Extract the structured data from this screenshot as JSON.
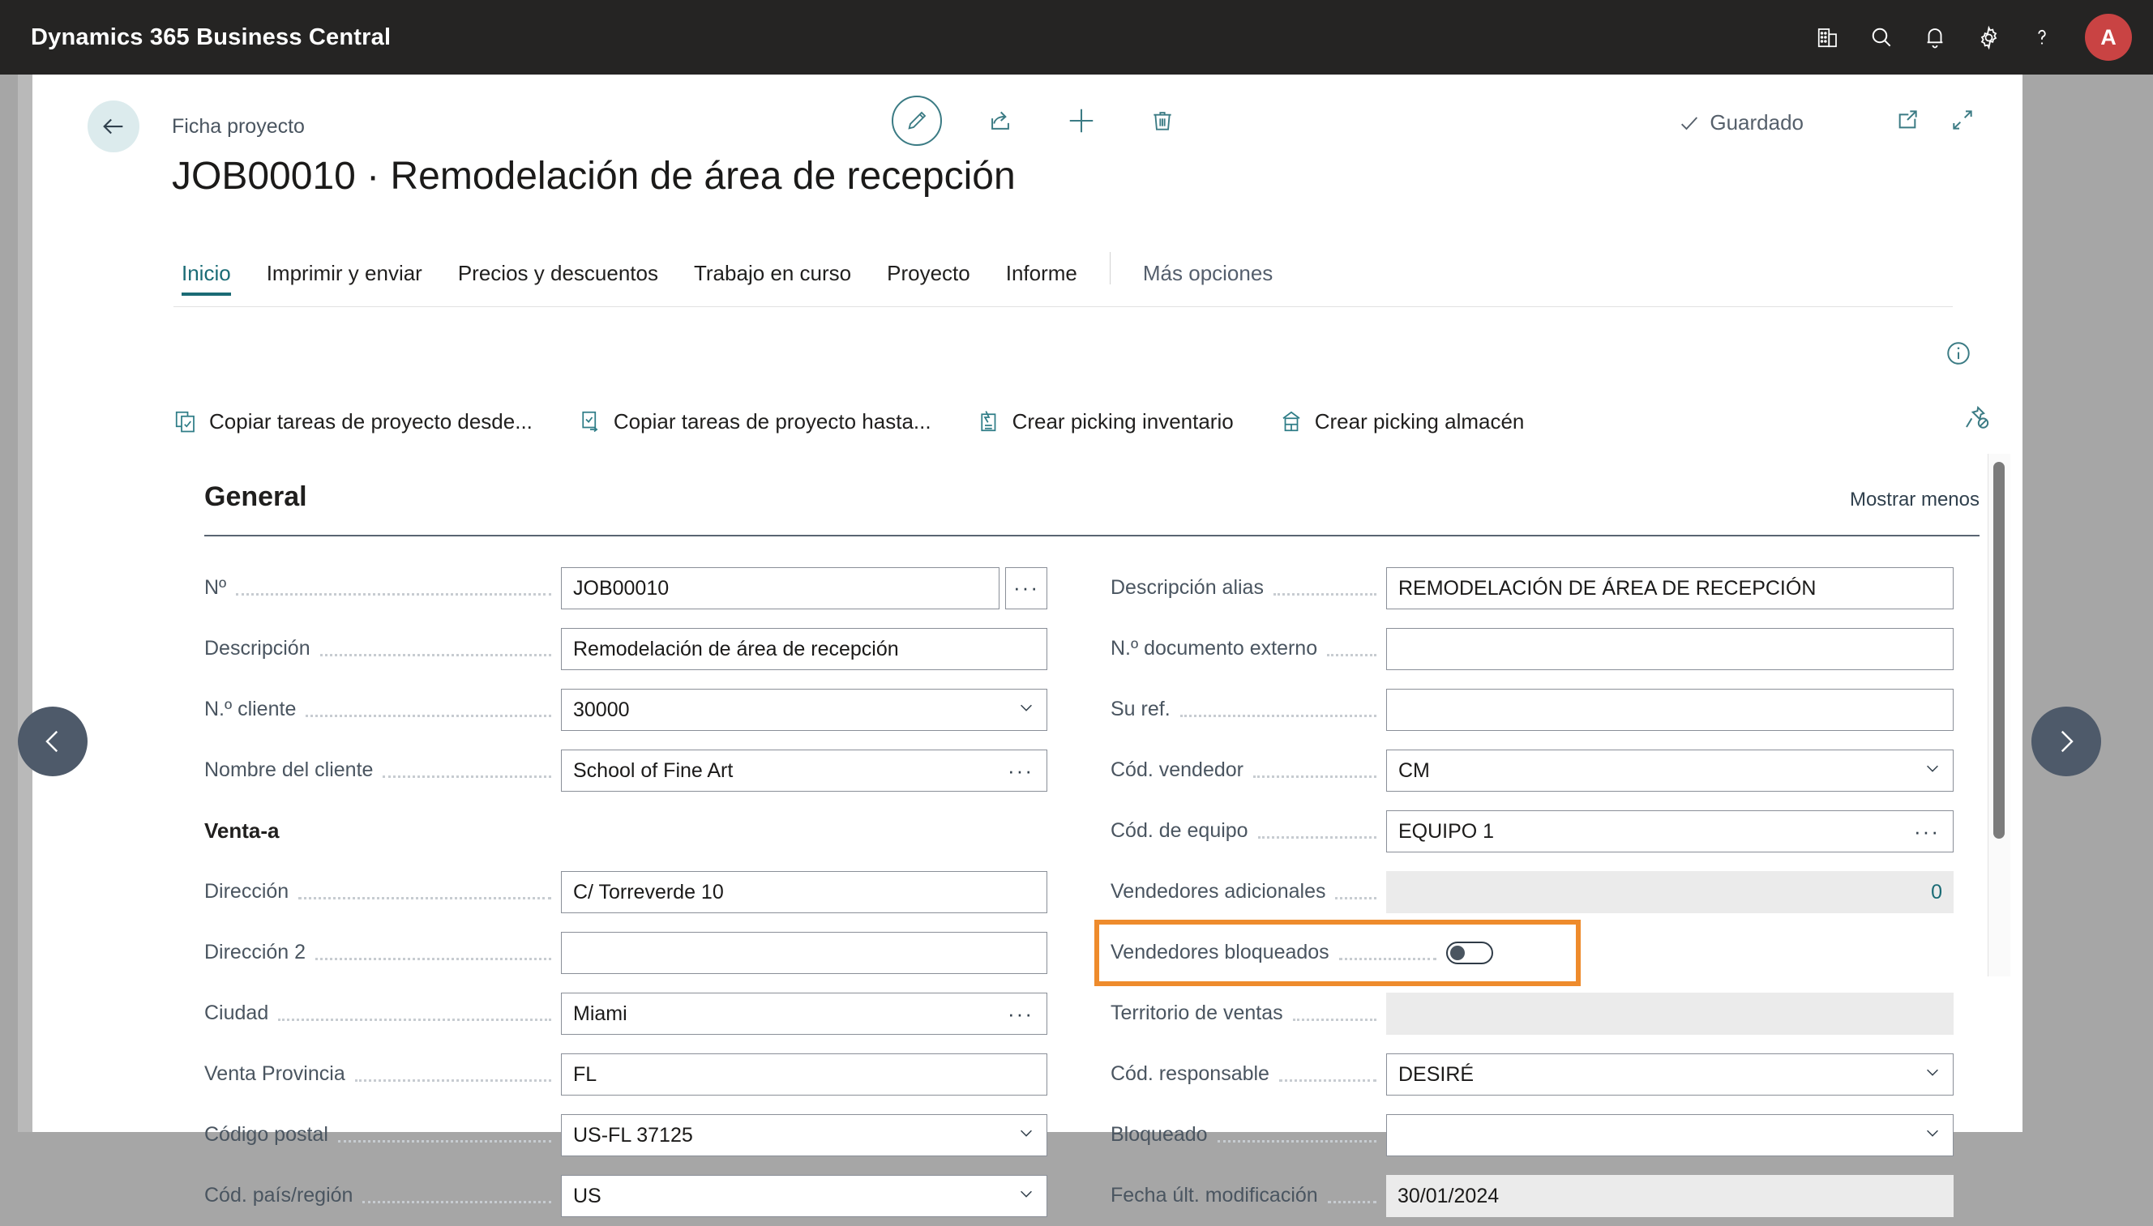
{
  "app": {
    "brand": "Dynamics 365 Business Central",
    "avatar_initial": "A",
    "accent_teal": "#3b7b84",
    "highlight_orange": "#ee8b2c",
    "topbar_bg": "#252423",
    "icons": [
      "company-icon",
      "search-icon",
      "notification-bell-icon",
      "settings-gear-icon",
      "help-question-icon"
    ]
  },
  "command_bar": {
    "back_label": "back-arrow",
    "breadcrumb": "Ficha proyecto",
    "edit_label": "edit-pencil",
    "share_label": "share",
    "new_label": "new",
    "delete_label": "delete",
    "saved_status": "Guardado",
    "open_new_window_label": "open-in-new-window",
    "collapse_label": "collapse"
  },
  "document": {
    "title": "JOB00010 · Remodelación de área de recepción"
  },
  "tabs": [
    {
      "label": "Inicio",
      "active": true
    },
    {
      "label": "Imprimir y enviar",
      "active": false
    },
    {
      "label": "Precios y descuentos",
      "active": false
    },
    {
      "label": "Trabajo en curso",
      "active": false
    },
    {
      "label": "Proyecto",
      "active": false
    },
    {
      "label": "Informe",
      "active": false
    }
  ],
  "tabs_more": "Más opciones",
  "actions": [
    {
      "label": "Copiar tareas de proyecto desde...",
      "icon": "copy-tasks-from-icon"
    },
    {
      "label": "Copiar tareas de proyecto hasta...",
      "icon": "copy-tasks-to-icon"
    },
    {
      "label": "Crear picking inventario",
      "icon": "inventory-pick-icon"
    },
    {
      "label": "Crear picking almacén",
      "icon": "warehouse-pick-icon"
    }
  ],
  "section": {
    "title": "General",
    "toggle_link": "Mostrar menos"
  },
  "form": {
    "left": [
      {
        "type": "field",
        "label": "Nº",
        "value": "JOB00010",
        "control": "assist"
      },
      {
        "type": "field",
        "label": "Descripción",
        "value": "Remodelación de área de recepción",
        "control": "none"
      },
      {
        "type": "field",
        "label": "N.º cliente",
        "value": "30000",
        "control": "dropdown"
      },
      {
        "type": "field",
        "label": "Nombre del cliente",
        "value": "School of Fine Art",
        "control": "ellipsis"
      },
      {
        "type": "subheading",
        "label": "Venta-a"
      },
      {
        "type": "field",
        "label": "Dirección",
        "value": "C/ Torreverde 10",
        "control": "none"
      },
      {
        "type": "field",
        "label": "Dirección 2",
        "value": "",
        "control": "none"
      },
      {
        "type": "field",
        "label": "Ciudad",
        "value": "Miami",
        "control": "ellipsis"
      },
      {
        "type": "field",
        "label": "Venta Provincia",
        "value": "FL",
        "control": "none"
      },
      {
        "type": "field",
        "label": "Código postal",
        "value": "US-FL 37125",
        "control": "dropdown"
      },
      {
        "type": "field",
        "label": "Cód. país/región",
        "value": "US",
        "control": "dropdown"
      }
    ],
    "right": [
      {
        "type": "field",
        "label": "Descripción alias",
        "value": "REMODELACIÓN DE ÁREA DE RECEPCIÓN",
        "control": "none"
      },
      {
        "type": "field",
        "label": "N.º documento externo",
        "value": "",
        "control": "none"
      },
      {
        "type": "field",
        "label": "Su ref.",
        "value": "",
        "control": "none"
      },
      {
        "type": "field",
        "label": "Cód. vendedor",
        "value": "CM",
        "control": "dropdown"
      },
      {
        "type": "field",
        "label": "Cód. de equipo",
        "value": "EQUIPO 1",
        "control": "ellipsis"
      },
      {
        "type": "field",
        "label": "Vendedores adicionales",
        "value": "0",
        "control": "readonly-number"
      },
      {
        "type": "toggle",
        "label": "Vendedores bloqueados",
        "value": "off",
        "highlighted": true
      },
      {
        "type": "field",
        "label": "Territorio de ventas",
        "value": "",
        "control": "readonly"
      },
      {
        "type": "field",
        "label": "Cód. responsable",
        "value": "DESIRÉ",
        "control": "dropdown"
      },
      {
        "type": "field",
        "label": "Bloqueado",
        "value": "",
        "control": "dropdown"
      },
      {
        "type": "field",
        "label": "Fecha últ. modificación",
        "value": "30/01/2024",
        "control": "readonly"
      }
    ]
  },
  "navigation": {
    "prev_label": "previous-record",
    "next_label": "next-record"
  }
}
